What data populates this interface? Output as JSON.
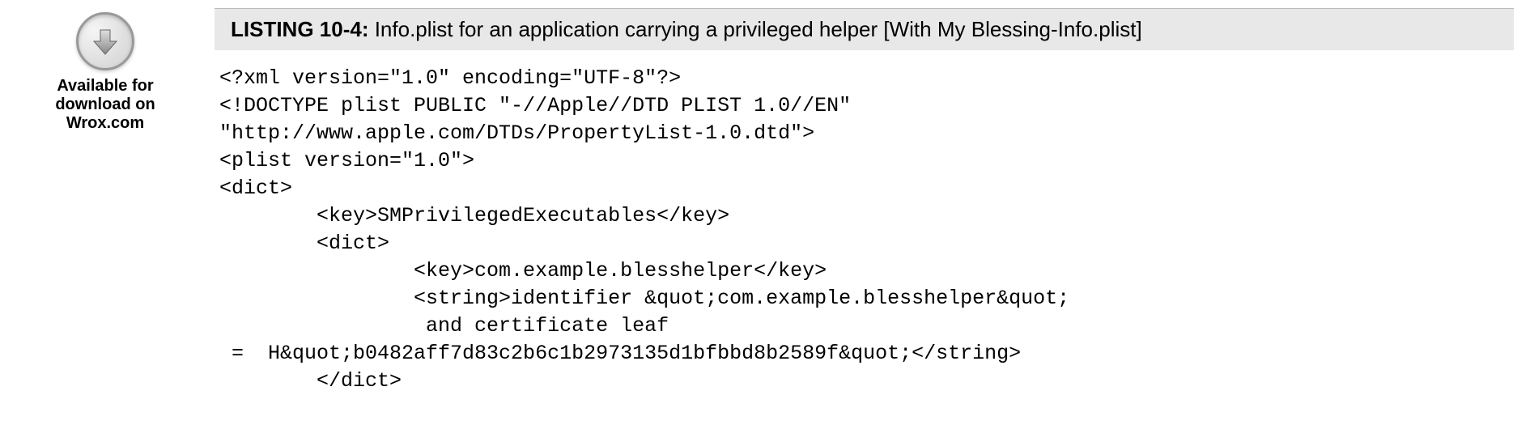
{
  "download": {
    "line1": "Available for",
    "line2": "download on",
    "line3": "Wrox.com"
  },
  "listing": {
    "number": "LISTING 10-4:",
    "title": "  Info.plist for an application carrying a privileged helper [With My Blessing-Info.plist]"
  },
  "code": "<?xml version=\"1.0\" encoding=\"UTF-8\"?>\n<!DOCTYPE plist PUBLIC \"-//Apple//DTD PLIST 1.0//EN\"\n\"http://www.apple.com/DTDs/PropertyList-1.0.dtd\">\n<plist version=\"1.0\">\n<dict>\n        <key>SMPrivilegedExecutables</key>\n        <dict>\n                <key>com.example.blesshelper</key>\n                <string>identifier &quot;com.example.blesshelper&quot;\n                 and certificate leaf\n =  H&quot;b0482aff7d83c2b6c1b2973135d1bfbbd8b2589f&quot;</string>\n        </dict>"
}
